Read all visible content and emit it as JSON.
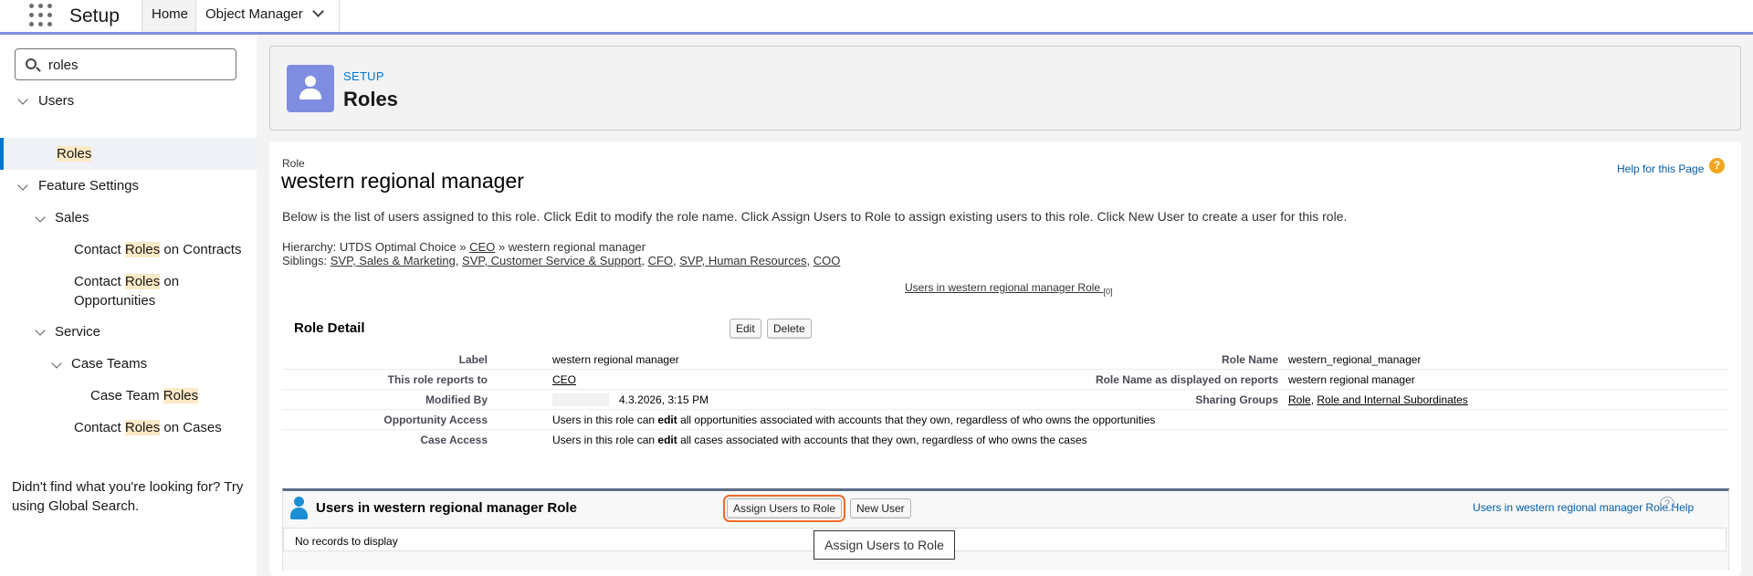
{
  "topbar": {
    "app_title": "Setup",
    "tabs": [
      {
        "label": "Home"
      },
      {
        "label": "Object Manager"
      }
    ]
  },
  "sidebar": {
    "search_value": "roles",
    "tree": {
      "users": "Users",
      "roles": "Roles",
      "feature_settings": "Feature Settings",
      "sales": "Sales",
      "contact_roles_contracts": {
        "pre": "Contact ",
        "hl": "Roles",
        "post": " on Contracts"
      },
      "contact_roles_opps_line1": {
        "pre": "Contact ",
        "hl": "Roles",
        "post": " on"
      },
      "contact_roles_opps_line2": "Opportunities",
      "service": "Service",
      "case_teams": "Case Teams",
      "case_team_roles": {
        "pre": "Case Team ",
        "hl": "Roles"
      },
      "contact_roles_cases": {
        "pre": "Contact ",
        "hl": "Roles",
        "post": " on Cases"
      }
    },
    "not_found": "Didn't find what you're looking for? Try using Global Search."
  },
  "header": {
    "breadcrumb": "SETUP",
    "title": "Roles",
    "icon": "user-icon"
  },
  "role": {
    "small_label": "Role",
    "name": "western regional manager",
    "help_link": "Help for this Page",
    "description": "Below is the list of users assigned to this role. Click Edit to modify the role name. Click Assign Users to Role to assign existing users to this role. Click New User to create a user for this role.",
    "hierarchy": {
      "prefix": "Hierarchy: UTDS Optimal Choice » ",
      "ceo": "CEO",
      "suffix": " » western regional manager"
    },
    "siblings": {
      "prefix": "Siblings: ",
      "items": [
        "SVP, Sales & Marketing",
        "SVP, Customer Service & Support",
        "CFO",
        "SVP, Human Resources",
        "COO"
      ]
    },
    "users_link": "Users in western regional manager Role",
    "users_count": "[0]"
  },
  "detail": {
    "title": "Role Detail",
    "edit": "Edit",
    "delete": "Delete",
    "label_label": "Label",
    "label_value": "western regional manager",
    "role_name_label": "Role Name",
    "role_name_value": "western_regional_manager",
    "reports_to_label": "This role reports to",
    "reports_to_value": "CEO",
    "role_reports_label": "Role Name as displayed on reports",
    "role_reports_value": "western regional manager",
    "modified_label": "Modified By",
    "modified_value": "4.3.2026, 3:15 PM",
    "sharing_label": "Sharing Groups",
    "sharing_role": "Role",
    "sharing_role_internal": "Role and Internal Subordinates",
    "opp_access_label": "Opportunity Access",
    "opp_access": {
      "pre": "Users in this role can ",
      "bold": "edit",
      "post": " all opportunities associated with accounts that they own, regardless of who owns the opportunities"
    },
    "case_access_label": "Case Access",
    "case_access": {
      "pre": "Users in this role can ",
      "bold": "edit",
      "post": " all cases associated with accounts that they own, regardless of who owns the cases"
    }
  },
  "related": {
    "title": "Users in western regional manager Role",
    "assign_button": "Assign Users to Role",
    "new_user_button": "New User",
    "help": "Users in western regional manager Role Help",
    "help_icon": "?",
    "no_records": "No records to display",
    "tooltip": "Assign Users to Role"
  },
  "colors": {
    "accent": "#7f8de1",
    "link": "#0176d3",
    "highlight": "#fde9c5",
    "focus": "#ee6a2a"
  }
}
